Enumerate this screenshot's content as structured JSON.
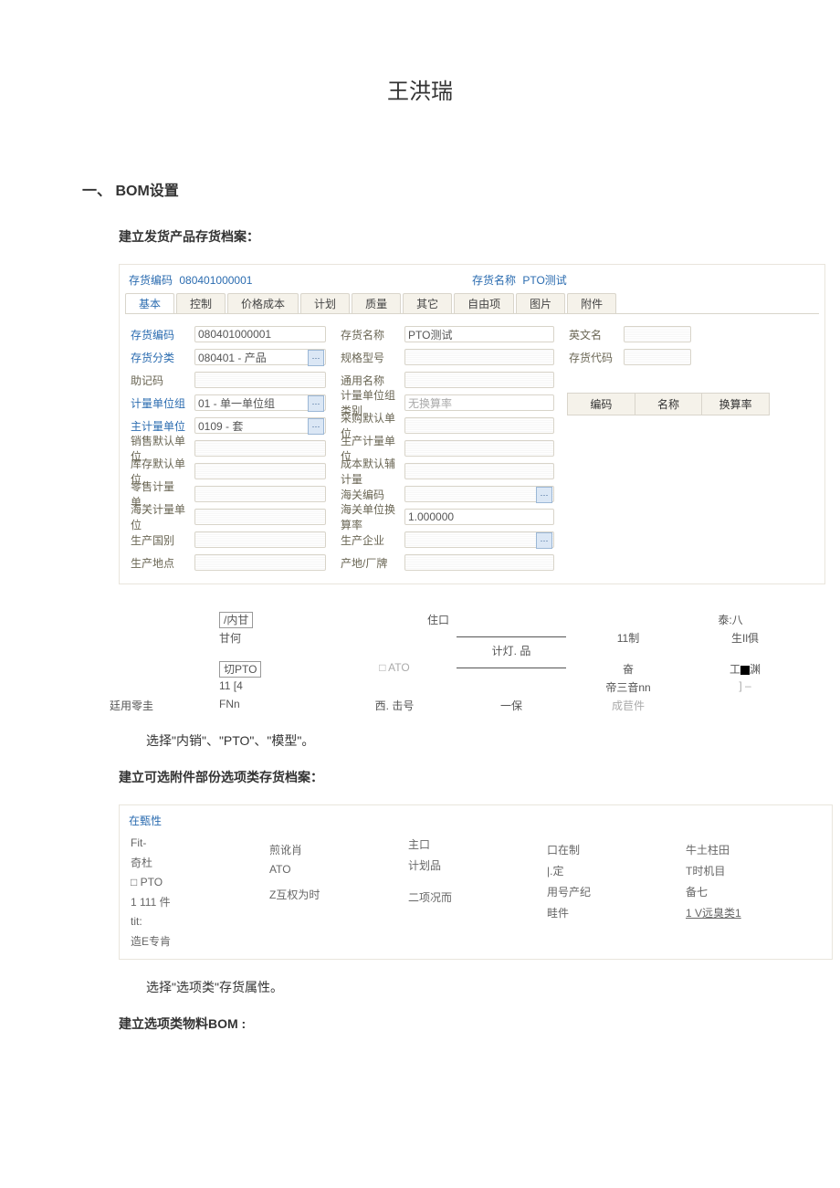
{
  "doc_title": "王洪瑞",
  "section1": {
    "heading": "一、  BOM设置"
  },
  "sub1": "建立发货产品存货档案：",
  "form": {
    "top_left_label": "存货编码",
    "top_left_value": "080401000001",
    "top_right_label": "存货名称",
    "top_right_value": "PTO测试",
    "tabs": [
      "基本",
      "控制",
      "价格成本",
      "计划",
      "质量",
      "其它",
      "自由项",
      "图片",
      "附件"
    ],
    "col1": [
      {
        "label": "存货编码",
        "link": true,
        "value": "080401000001"
      },
      {
        "label": "存货分类",
        "link": true,
        "value": "080401 - 产品",
        "picker": true
      },
      {
        "label": "助记码",
        "value": ""
      },
      {
        "label": "计量单位组",
        "link": true,
        "value": "01 - 单一单位组",
        "picker": true
      },
      {
        "label": "主计量单位",
        "link": true,
        "value": "0109 - 套",
        "picker": true
      },
      {
        "label": "销售默认单位",
        "value": ""
      },
      {
        "label": "库存默认单位",
        "value": ""
      },
      {
        "label": "零售计量单…",
        "value": ""
      },
      {
        "label": "海关计量单位",
        "value": ""
      },
      {
        "label": "生产国别",
        "value": ""
      },
      {
        "label": "生产地点",
        "value": ""
      }
    ],
    "col2": [
      {
        "label": "存货名称",
        "value": "PTO测试"
      },
      {
        "label": "规格型号",
        "value": ""
      },
      {
        "label": "通用名称",
        "value": ""
      },
      {
        "label": "计量单位组类别",
        "value": "无换算率",
        "dropdown": true
      },
      {
        "label": "采购默认单位",
        "value": ""
      },
      {
        "label": "生产计量单位",
        "value": ""
      },
      {
        "label": "成本默认辅计量",
        "value": ""
      },
      {
        "label": "海关编码",
        "value": "",
        "picker": true
      },
      {
        "label": "海关单位换算率",
        "value": "1.000000"
      },
      {
        "label": "生产企业",
        "value": "",
        "picker": true
      },
      {
        "label": "产地/厂牌",
        "value": ""
      }
    ],
    "col3": [
      {
        "label": "英文名"
      },
      {
        "label": "存货代码"
      }
    ],
    "mini_table_headers": [
      "编码",
      "名称",
      "换算率"
    ]
  },
  "opt1": {
    "r1": [
      "/内甘",
      "住口",
      "",
      "泰:八"
    ],
    "r2": [
      "甘何",
      "",
      "计灯. 品",
      "11制",
      "生Il俱"
    ],
    "r3": [
      "切PTO",
      "□ ATO",
      "",
      "奋",
      "工■渊"
    ],
    "r4": [
      "11 [4",
      "",
      "",
      "帝三音nn",
      "] –"
    ],
    "r5_left": "廷用零圭",
    "r5": [
      "FNn",
      "西. 击号",
      "一保",
      "成苣件",
      ""
    ]
  },
  "note1": "选择\"内销\"、\"PTO\"、\"模型\"。",
  "sub2": "建立可选附件部份选项类存货档案：",
  "panel2": {
    "title": "在甄性",
    "rows": [
      [
        "Fit-",
        "",
        "主口",
        "",
        ""
      ],
      [
        "奇杜",
        "煎讹肖",
        "计划品",
        "口在制",
        "牛土柱田"
      ],
      [
        "□ PTO",
        "ATO",
        "",
        "|.定",
        "T时机目"
      ],
      [
        "1 111 件",
        "",
        "",
        "用号产纪",
        "备七"
      ],
      [
        "tit:",
        "Z互权为时",
        "二项况而",
        "畦件",
        "1 V远臭类1"
      ],
      [
        "造E专肯",
        "",
        "",
        "",
        ""
      ]
    ]
  },
  "note2": "选择\"选项类\"存货属性。",
  "sub3": "建立选项类物料BOM :"
}
